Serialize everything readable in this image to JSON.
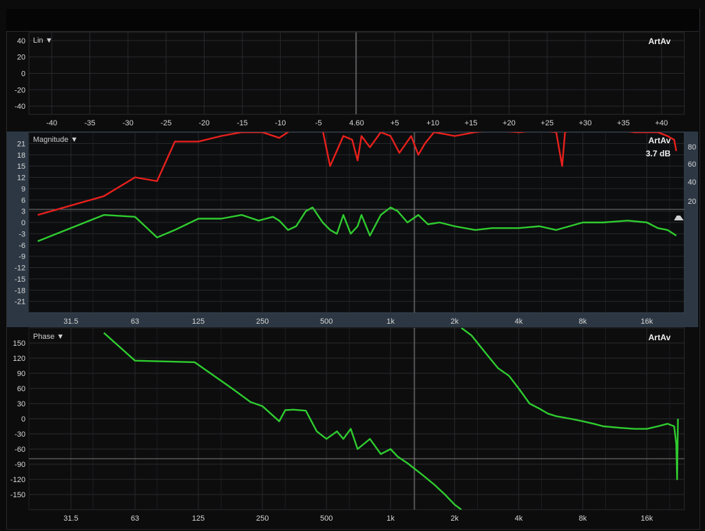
{
  "lin_panel": {
    "title": "Lin ▼",
    "brand": "ArtAv",
    "y_ticks": [
      "40",
      "20",
      "0",
      "-20",
      "-40"
    ],
    "x_ticks": [
      "-40",
      "-35",
      "-30",
      "-25",
      "-20",
      "-15",
      "-10",
      "-5",
      "4.60",
      "+5",
      "+10",
      "+15",
      "+20",
      "+25",
      "+30",
      "+35",
      "+40"
    ]
  },
  "magnitude_panel": {
    "title": "Magnitude ▼",
    "brand": "ArtAv",
    "readout": "3.7 dB",
    "y_ticks": [
      "21",
      "18",
      "15",
      "12",
      "9",
      "6",
      "3",
      "0",
      "-3",
      "-6",
      "-9",
      "-12",
      "-15",
      "-18",
      "-21"
    ],
    "right_ticks": [
      "80",
      "60",
      "40",
      "20"
    ],
    "x_ticks": [
      "31.5",
      "63",
      "125",
      "250",
      "500",
      "1k",
      "2k",
      "4k",
      "8k",
      "16k"
    ]
  },
  "phase_panel": {
    "title": "Phase ▼",
    "brand": "ArtAv",
    "y_ticks": [
      "150",
      "120",
      "90",
      "60",
      "30",
      "0",
      "-30",
      "-60",
      "-90",
      "-120",
      "-150"
    ],
    "x_ticks": [
      "31.5",
      "63",
      "125",
      "250",
      "500",
      "1k",
      "2k",
      "4k",
      "8k",
      "16k"
    ]
  },
  "colors": {
    "magnitude": "#e8201c",
    "coherence": "#2fcc2f",
    "phase": "#2fcc2f",
    "mag_bg": "#2c3743"
  },
  "chart_data": [
    {
      "type": "line",
      "panel": "lin",
      "title": "",
      "xlabel": "",
      "ylabel": "",
      "xlim": [
        -43,
        43
      ],
      "ylim": [
        -50,
        50
      ],
      "series": []
    },
    {
      "type": "line",
      "panel": "magnitude",
      "title": "",
      "xlabel": "",
      "ylabel": "",
      "x_scale": "log",
      "xlim": [
        20,
        24000
      ],
      "ylim": [
        -24,
        24
      ],
      "series": [
        {
          "color": "#e8201c",
          "x": [
            22,
            45,
            63,
            80,
            97,
            125,
            160,
            200,
            250,
            300,
            350,
            400,
            480,
            520,
            600,
            660,
            700,
            730,
            800,
            900,
            1000,
            1100,
            1250,
            1350,
            1450,
            1600,
            1800,
            2000,
            2500,
            3000,
            4000,
            5000,
            6000,
            6400,
            6600,
            7000,
            8000,
            10000,
            12000,
            14000,
            16000,
            18000,
            20000,
            21500,
            22000
          ],
          "y": [
            2,
            7,
            12,
            11,
            21.5,
            21.5,
            23,
            24,
            24,
            22.5,
            25,
            25,
            24.5,
            15,
            23,
            22,
            16.5,
            23,
            20,
            24,
            23,
            18.5,
            23,
            18,
            21,
            24,
            23.5,
            23,
            24,
            24.5,
            24,
            24.5,
            24,
            15,
            24,
            24.5,
            24.5,
            25,
            24.5,
            24,
            24,
            24,
            23,
            22,
            19
          ]
        },
        {
          "color": "#2fcc2f",
          "x": [
            22,
            45,
            63,
            80,
            97,
            125,
            160,
            200,
            240,
            280,
            300,
            330,
            360,
            400,
            430,
            480,
            520,
            560,
            600,
            650,
            700,
            730,
            800,
            900,
            1000,
            1080,
            1200,
            1350,
            1500,
            1700,
            2000,
            2500,
            3000,
            4000,
            5000,
            6000,
            8000,
            10000,
            13000,
            16000,
            18000,
            20000,
            22000
          ],
          "y": [
            -5,
            2,
            1.5,
            -4,
            -2,
            1,
            1,
            2,
            0.5,
            1.5,
            0.5,
            -2,
            -1,
            3,
            4,
            0,
            -2,
            -3,
            2,
            -3,
            -1,
            2,
            -3.5,
            2,
            4,
            3,
            0,
            2,
            -0.5,
            0,
            -1,
            -2,
            -1.5,
            -1.5,
            -1,
            -2,
            0,
            0,
            0.5,
            0,
            -1.5,
            -2,
            -3.5
          ]
        }
      ]
    },
    {
      "type": "line",
      "panel": "phase",
      "title": "",
      "xlabel": "",
      "ylabel": "",
      "x_scale": "log",
      "xlim": [
        20,
        24000
      ],
      "ylim": [
        -180,
        180
      ],
      "series": [
        {
          "color": "#2fcc2f",
          "x": [
            45,
            63,
            120,
            180,
            220,
            250,
            300,
            320,
            350,
            400,
            450,
            500,
            560,
            600,
            650,
            700,
            800,
            900,
            1000,
            1080,
            1200,
            1400,
            1600,
            1800,
            2000,
            2150
          ],
          "y": [
            170,
            115,
            112,
            60,
            33,
            25,
            -5,
            17,
            18,
            16,
            -25,
            -40,
            -25,
            -40,
            -20,
            -60,
            -40,
            -70,
            -60,
            -75,
            -88,
            -110,
            -130,
            -150,
            -170,
            -180
          ]
        },
        {
          "color": "#2fcc2f",
          "x": [
            2150,
            2400,
            2800,
            3200,
            3600,
            4000,
            4500,
            5000,
            5500,
            6000,
            7000,
            8000,
            9000,
            10000,
            12000,
            14000,
            16000,
            18000,
            20000,
            21500,
            22000,
            22200,
            22400
          ],
          "y": [
            180,
            165,
            130,
            100,
            85,
            60,
            30,
            20,
            10,
            5,
            0,
            -5,
            -10,
            -15,
            -18,
            -20,
            -20,
            -15,
            -10,
            -15,
            -50,
            -120,
            0
          ]
        }
      ]
    }
  ]
}
